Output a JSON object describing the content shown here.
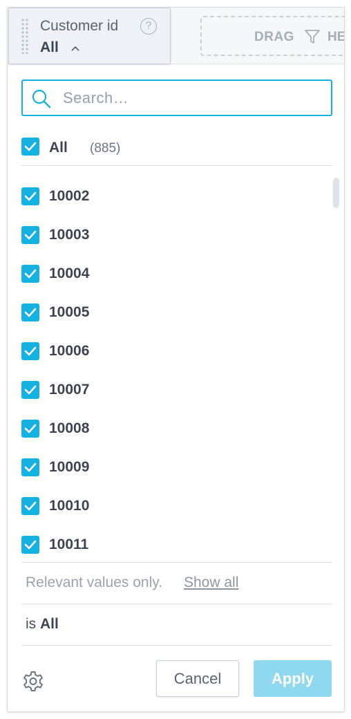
{
  "filter": {
    "title": "Customer id",
    "help_symbol": "?",
    "value": "All"
  },
  "drop_zone": {
    "text": "DRAG",
    "text_cut": "HE"
  },
  "search": {
    "placeholder": "Search…"
  },
  "all_option": {
    "label": "All",
    "count": "(885)",
    "checked": true
  },
  "items": [
    {
      "label": "10002",
      "checked": true
    },
    {
      "label": "10003",
      "checked": true
    },
    {
      "label": "10004",
      "checked": true
    },
    {
      "label": "10005",
      "checked": true
    },
    {
      "label": "10006",
      "checked": true
    },
    {
      "label": "10007",
      "checked": true
    },
    {
      "label": "10008",
      "checked": true
    },
    {
      "label": "10009",
      "checked": true
    },
    {
      "label": "10010",
      "checked": true
    },
    {
      "label": "10011",
      "checked": true
    }
  ],
  "footer": {
    "relevant_text": "Relevant values only.",
    "show_all_link": "Show all",
    "is_prefix": "is",
    "is_value": "All",
    "cancel_label": "Cancel",
    "apply_label": "Apply"
  },
  "colors": {
    "accent": "#14b2e2",
    "apply_disabled": "#8ed8f0"
  }
}
